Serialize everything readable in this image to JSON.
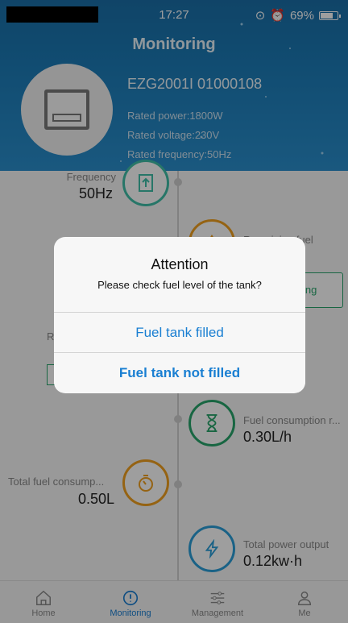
{
  "status_bar": {
    "time": "17:27",
    "battery": "69%"
  },
  "header": {
    "title": "Monitoring",
    "device_name": "EZG2001I 01000108",
    "rated_power": "Rated power:1800W",
    "rated_voltage": "Rated voltage:230V",
    "rated_frequency": "Rated frequency:50Hz"
  },
  "metrics": {
    "frequency_label": "Frequency",
    "frequency_value": "50Hz",
    "remaining_fuel_label": "Remaining fuel",
    "after_filling_label": "After filling",
    "fuel_consumption_rate_label": "Fuel consumption r...",
    "fuel_consumption_rate_value": "0.30L/h",
    "total_fuel_label": "Total fuel consump...",
    "total_fuel_value": "0.50L",
    "total_power_label": "Total power output",
    "total_power_value": "0.12kw·h"
  },
  "dialog": {
    "title": "Attention",
    "message": "Please check fuel level of the tank?",
    "button_filled": "Fuel tank filled",
    "button_not_filled": "Fuel tank not filled"
  },
  "tabs": [
    {
      "label": "Home",
      "icon": "home-icon"
    },
    {
      "label": "Monitoring",
      "icon": "monitoring-icon",
      "active": true
    },
    {
      "label": "Management",
      "icon": "sliders-icon"
    },
    {
      "label": "Me",
      "icon": "user-icon"
    }
  ],
  "colors": {
    "header": "#1c7cb8",
    "accent": "#1a7fd2",
    "teal": "#3fbfa8",
    "green": "#27a56b",
    "orange": "#f0a020",
    "blue": "#2a9ed8"
  }
}
